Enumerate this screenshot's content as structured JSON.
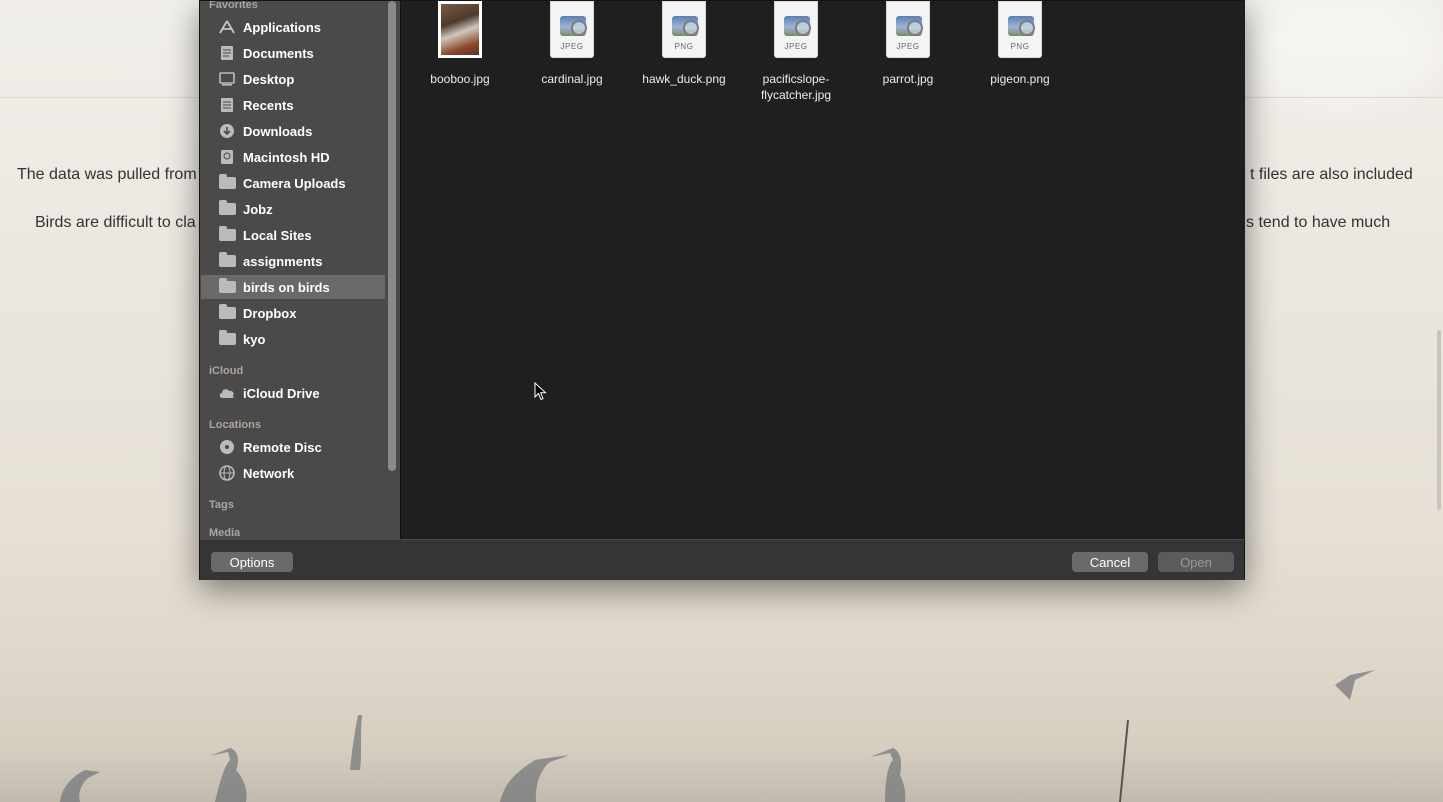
{
  "page": {
    "paragraph1_left": "The data was pulled from",
    "paragraph1_right": "t files are also included",
    "paragraph2_left": "Birds are difficult to cla",
    "paragraph2_right": "s tend to have much"
  },
  "sidebar": {
    "favorites_heading": "Favorites",
    "favorites": [
      {
        "label": "Applications",
        "icon": "applications-icon"
      },
      {
        "label": "Documents",
        "icon": "documents-icon"
      },
      {
        "label": "Desktop",
        "icon": "desktop-icon"
      },
      {
        "label": "Recents",
        "icon": "recents-icon"
      },
      {
        "label": "Downloads",
        "icon": "downloads-icon"
      },
      {
        "label": "Macintosh HD",
        "icon": "hard-drive-icon"
      },
      {
        "label": "Camera Uploads",
        "icon": "folder-icon"
      },
      {
        "label": "Jobz",
        "icon": "folder-icon"
      },
      {
        "label": "Local Sites",
        "icon": "folder-icon"
      },
      {
        "label": "assignments",
        "icon": "folder-icon"
      },
      {
        "label": "birds on birds",
        "icon": "folder-icon",
        "selected": true
      },
      {
        "label": "Dropbox",
        "icon": "folder-icon"
      },
      {
        "label": "kyo",
        "icon": "folder-icon"
      }
    ],
    "icloud_heading": "iCloud",
    "icloud": [
      {
        "label": "iCloud Drive",
        "icon": "cloud-icon"
      }
    ],
    "locations_heading": "Locations",
    "locations": [
      {
        "label": "Remote Disc",
        "icon": "disc-icon"
      },
      {
        "label": "Network",
        "icon": "network-icon"
      }
    ],
    "tags_heading": "Tags",
    "media_heading": "Media"
  },
  "files": [
    {
      "name": "booboo.jpg",
      "kind": "photo"
    },
    {
      "name": "cardinal.jpg",
      "type": "JPEG"
    },
    {
      "name": "hawk_duck.png",
      "type": "PNG"
    },
    {
      "name_line1": "pacificslope-",
      "name_line2": "flycatcher.jpg",
      "type": "JPEG"
    },
    {
      "name": "parrot.jpg",
      "type": "JPEG"
    },
    {
      "name": "pigeon.png",
      "type": "PNG"
    }
  ],
  "footer": {
    "options_label": "Options",
    "cancel_label": "Cancel",
    "open_label": "Open"
  },
  "colors": {
    "sidebar_bg": "#4c4a49",
    "content_bg": "#1f1f1f",
    "selected_item": "#6b6968",
    "footer_bg": "#353535"
  }
}
